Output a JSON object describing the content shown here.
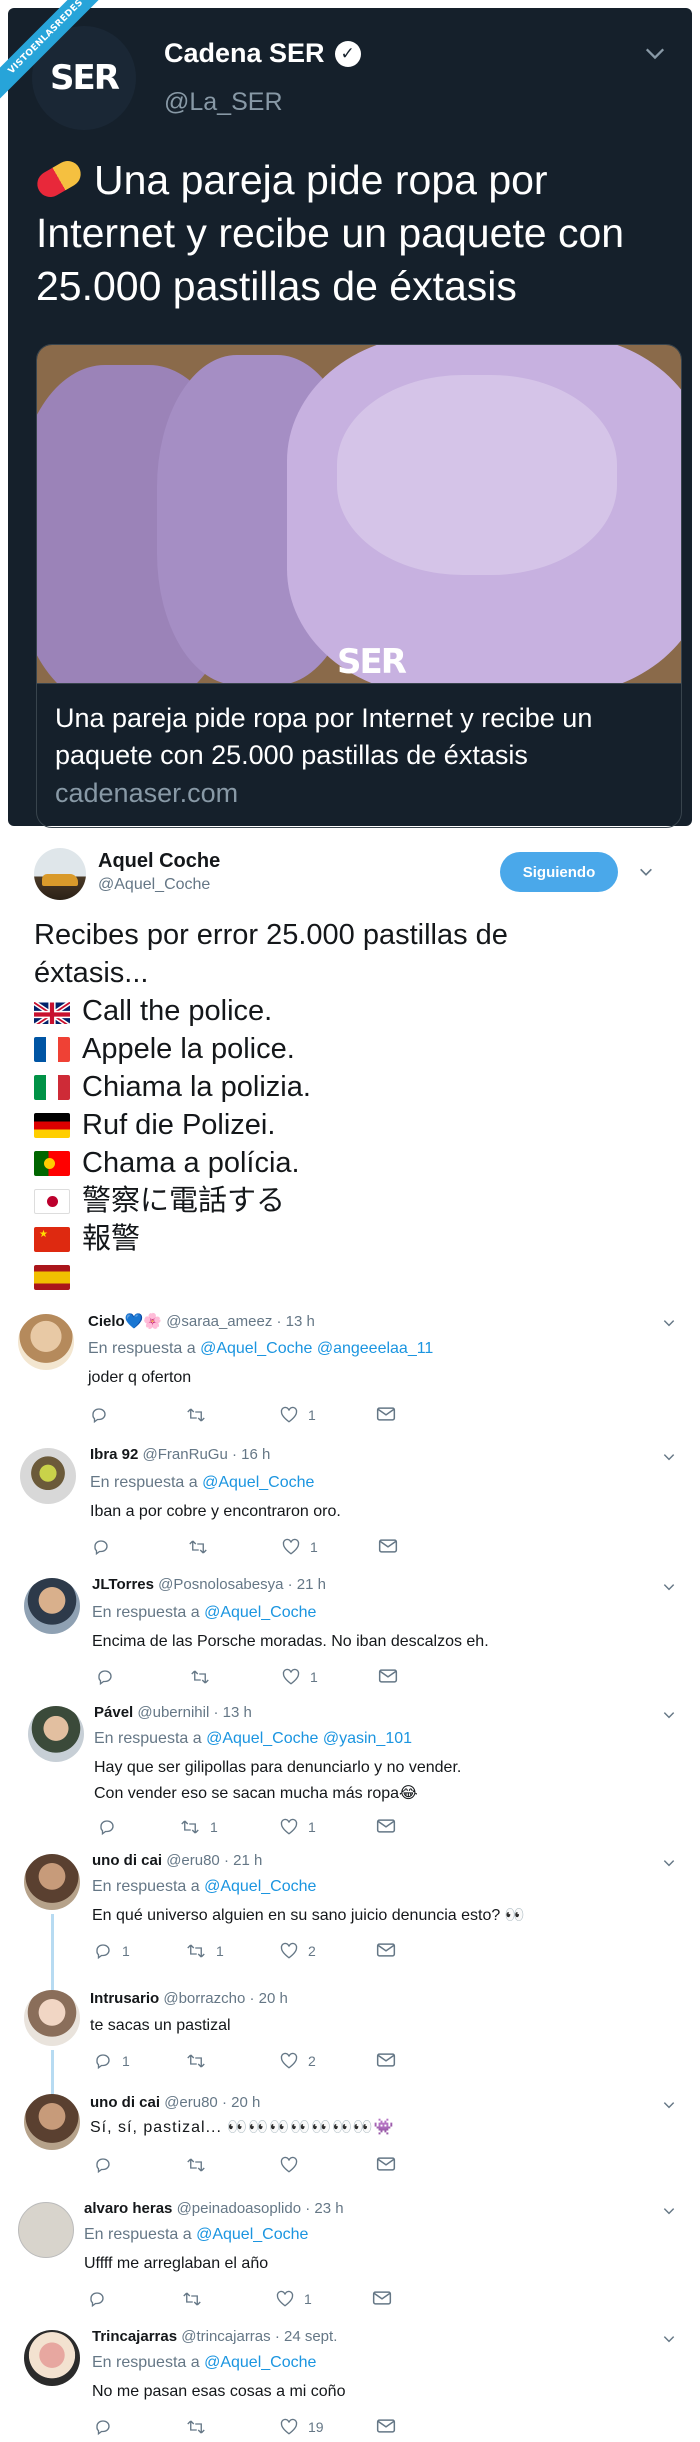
{
  "source": {
    "ribbon_text": "VISTOENLASREDES",
    "tweet": {
      "name": "Cadena SER",
      "handle": "@La_SER",
      "logo_text": "SER",
      "text": "Una pareja pide ropa por Internet y recibe un paquete con 25.000 pastillas de éxtasis",
      "card": {
        "image_watermark": "SER",
        "title": "Una pareja pide ropa por Internet y recibe un paquete con 25.000 pastillas de éxtasis",
        "domain": "cadenaser.com"
      }
    }
  },
  "main_tweet": {
    "name": "Aquel Coche",
    "handle": "@Aquel_Coche",
    "follow_label": "Siguiendo",
    "lines": [
      {
        "flag": "none",
        "text": "Recibes por error 25.000 pastillas de"
      },
      {
        "flag": "none",
        "text": "éxtasis..."
      },
      {
        "flag": "uk",
        "text": "Call the police."
      },
      {
        "flag": "fr",
        "text": "Appele la police."
      },
      {
        "flag": "it",
        "text": "Chiama la polizia."
      },
      {
        "flag": "de",
        "text": "Ruf die Polizei."
      },
      {
        "flag": "pt",
        "text": "Chama a polícia."
      },
      {
        "flag": "jp",
        "text": "警察に電話する"
      },
      {
        "flag": "cn",
        "text": "報警"
      },
      {
        "flag": "es",
        "text": ""
      }
    ]
  },
  "replies": [
    {
      "name": "Cielo💙🌸",
      "handle": "@saraa_ameez",
      "time": "· 13 h",
      "in_reply_prefix": "En respuesta a",
      "in_reply_mentions": "@Aquel_Coche @angeeelaa_11",
      "text": "joder q oferton",
      "replies_count": "",
      "retweets_count": "",
      "likes_count": "1"
    },
    {
      "name": "Ibra 92",
      "handle": "@FranRuGu",
      "time": "· 16 h",
      "in_reply_prefix": "En respuesta a",
      "in_reply_mentions": "@Aquel_Coche",
      "text": "Iban a por cobre y encontraron oro.",
      "replies_count": "",
      "retweets_count": "",
      "likes_count": "1"
    },
    {
      "name": "JLTorres",
      "handle": "@Posnolosabesya",
      "time": "· 21 h",
      "in_reply_prefix": "En respuesta a",
      "in_reply_mentions": "@Aquel_Coche",
      "text": "Encima de las Porsche moradas. No iban descalzos eh.",
      "replies_count": "",
      "retweets_count": "",
      "likes_count": "1"
    },
    {
      "name": "Pável",
      "handle": "@ubernihil",
      "time": "· 13 h",
      "in_reply_prefix": "En respuesta a",
      "in_reply_mentions": "@Aquel_Coche @yasin_101",
      "text": "Hay que ser gilipollas para denunciarlo y no vender.",
      "text2": "Con vender eso se sacan mucha más ropa😂",
      "replies_count": "",
      "retweets_count": "1",
      "likes_count": "1"
    },
    {
      "name": "uno di cai",
      "handle": "@eru80",
      "time": "· 21 h",
      "in_reply_prefix": "En respuesta a",
      "in_reply_mentions": "@Aquel_Coche",
      "text": "En qué universo alguien en su sano juicio denuncia esto? 👀",
      "replies_count": "1",
      "retweets_count": "1",
      "likes_count": "2"
    },
    {
      "name": "Intrusario",
      "handle": "@borrazcho",
      "time": "· 20 h",
      "text": "te sacas un pastizal",
      "replies_count": "1",
      "retweets_count": "",
      "likes_count": "2"
    },
    {
      "name": "uno di cai",
      "handle": "@eru80",
      "time": "· 20 h",
      "text": "Sí, sí, pastizal... 👀👀👀👀👀👀👀👾",
      "replies_count": "",
      "retweets_count": "",
      "likes_count": ""
    },
    {
      "name": "alvaro heras",
      "handle": "@peinadoasoplido",
      "time": "· 23 h",
      "in_reply_prefix": "En respuesta a",
      "in_reply_mentions": "@Aquel_Coche",
      "text": "Uffff me arreglaban el año",
      "replies_count": "",
      "retweets_count": "",
      "likes_count": "1"
    },
    {
      "name": "Trincajarras",
      "handle": "@trincajarras",
      "time": "· 24 sept.",
      "in_reply_prefix": "En respuesta a",
      "in_reply_mentions": "@Aquel_Coche",
      "text": "No me pasan esas cosas a mi coño",
      "replies_count": "",
      "retweets_count": "",
      "likes_count": "19"
    }
  ],
  "colors": {
    "dark_bg": "#15202b",
    "link_blue": "#1b95e0",
    "follow_blue": "#4aa8ea",
    "gray_text": "#657786",
    "thread_line": "#b7dbf2"
  }
}
